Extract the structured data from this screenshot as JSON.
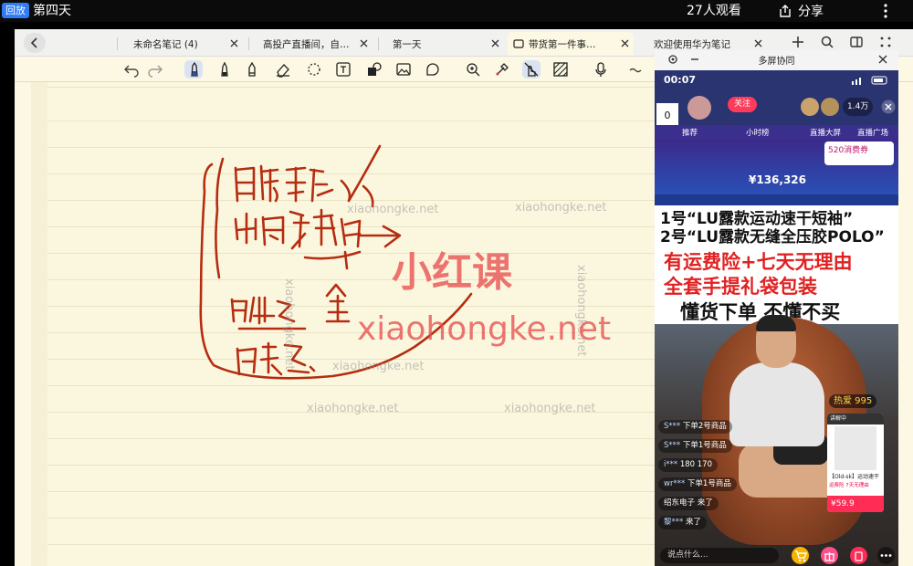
{
  "topbar": {
    "replay_badge": "回放",
    "title": "第四天",
    "viewers": "27人观看",
    "share_label": "分享"
  },
  "tabs": [
    {
      "label": "未命名笔记 (4)"
    },
    {
      "label": "高投产直播间，自…"
    },
    {
      "label": "第一天"
    },
    {
      "label": "带货第一件事…"
    },
    {
      "label": "欢迎使用华为笔记"
    }
  ],
  "tools": [
    "undo-icon",
    "redo-icon",
    "pen-icon",
    "marker-icon",
    "highlighter-icon",
    "eraser-icon",
    "lasso-icon",
    "text-icon",
    "shapes-icon",
    "image-icon",
    "sticker-icon",
    "zoom-icon",
    "color-picker-icon",
    "touch-pen-icon",
    "texture-icon",
    "mic-icon",
    "more-icon"
  ],
  "watermarks": {
    "brand_cn": "小红课",
    "brand_url": "xiaohongke.net",
    "url_small": "xiaohongke.net"
  },
  "popup": {
    "title": "多屏协同",
    "phone_time": "00:07",
    "counter": "0",
    "follow_label": "关注",
    "coupon": "520消费券",
    "amount": "¥136,326",
    "sign_lines": [
      "1号“LU露款运动速干短袖”",
      "2号“LU露款无缝全压胶POLO”",
      "有运费险+七天无理由",
      "全套手提礼袋包装",
      "懂货下单 不懂不买"
    ],
    "heat": "热爱 995",
    "product": {
      "price": "¥59.9"
    },
    "chat": [
      {
        "user": "S***",
        "text": "下单2号商品"
      },
      {
        "user": "S***",
        "text": "下单1号商品"
      },
      {
        "user": "i***",
        "text": "180 170"
      },
      {
        "user": "wr***",
        "text": "下单1号商品"
      },
      {
        "user": "",
        "text": "绍东电子 来了"
      },
      {
        "user": "黎***",
        "text": "来了"
      }
    ],
    "say_placeholder": "说点什么..."
  },
  "colors": {
    "accent": "#2f7cf6",
    "paper": "#fcf8e3",
    "ink": "#b52d10",
    "live_red": "#ff2d55"
  }
}
